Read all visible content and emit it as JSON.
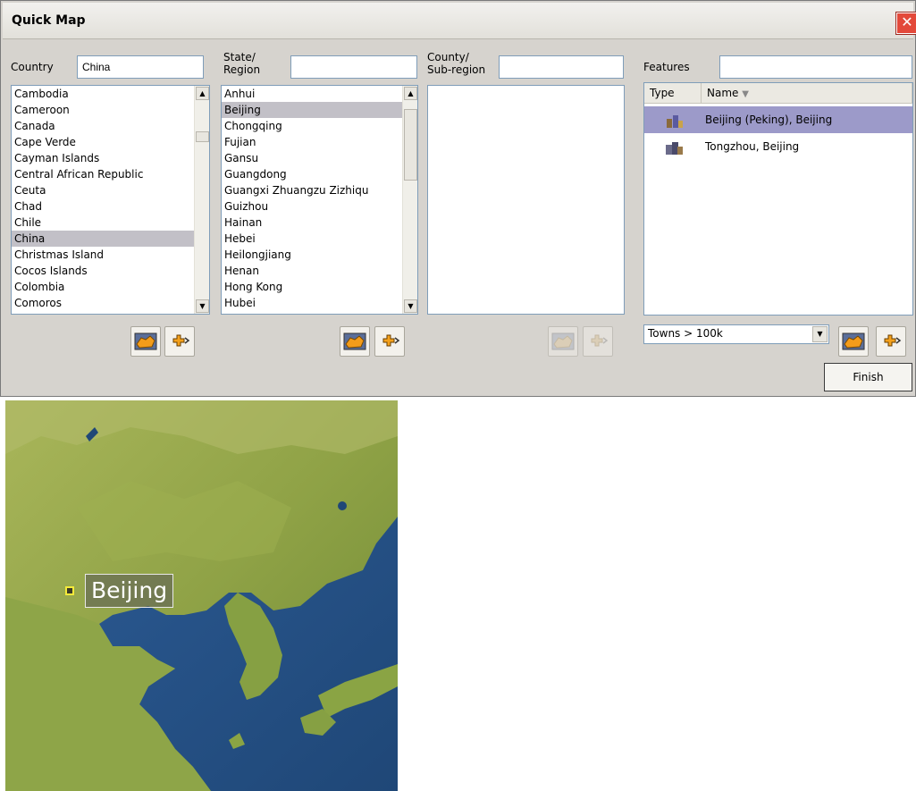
{
  "window": {
    "title": "Quick Map"
  },
  "country": {
    "label": "Country",
    "value": "China",
    "items": [
      "Cambodia",
      "Cameroon",
      "Canada",
      "Cape Verde",
      "Cayman Islands",
      "Central African Republic",
      "Ceuta",
      "Chad",
      "Chile",
      "China",
      "Christmas Island",
      "Cocos Islands",
      "Colombia",
      "Comoros"
    ],
    "selected": "China"
  },
  "state": {
    "label": "State/\nRegion",
    "value": "",
    "items": [
      "Anhui",
      "Beijing",
      "Chongqing",
      "Fujian",
      "Gansu",
      "Guangdong",
      "Guangxi Zhuangzu Zizhiqu",
      "Guizhou",
      "Hainan",
      "Hebei",
      "Heilongjiang",
      "Henan",
      "Hong Kong",
      "Hubei"
    ],
    "selected": "Beijing"
  },
  "county": {
    "label": "County/\nSub-region",
    "value": ""
  },
  "features": {
    "label": "Features",
    "value": "",
    "col_type": "Type",
    "col_name": "Name",
    "rows": [
      {
        "name": "Beijing (Peking), Beijing",
        "icon": "city-icon",
        "selected": true
      },
      {
        "name": "Tongzhou, Beijing",
        "icon": "town-icon",
        "selected": false
      }
    ],
    "filter": "Towns > 100k"
  },
  "buttons": {
    "finish": "Finish"
  },
  "map": {
    "label": "Beijing"
  },
  "colors": {
    "selection": "#c2c0c7",
    "feature_selection": "#9c9ac9",
    "dialog_bg": "#d6d3ce"
  }
}
